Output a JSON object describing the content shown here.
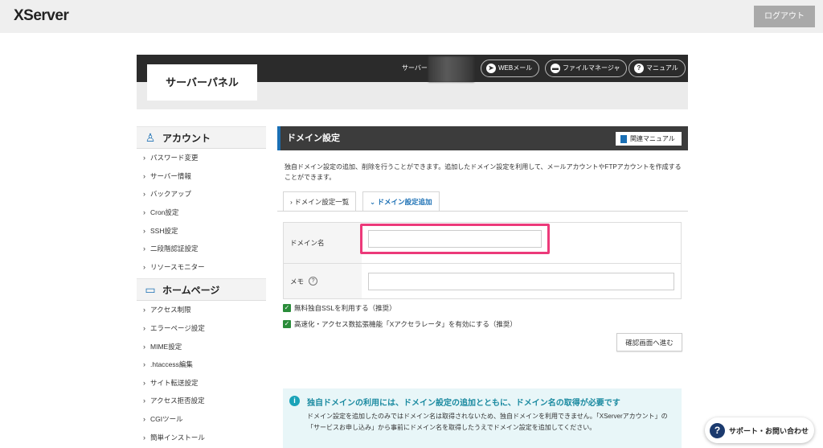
{
  "header": {
    "logo": "XServer",
    "logout_label": "ログアウト"
  },
  "panel": {
    "title": "サーバーパネル",
    "server_label": "サーバー",
    "web_mail": "WEBメール",
    "file_manager": "ファイルマネージャ",
    "manual": "マニュアル"
  },
  "sidebar": {
    "account_heading": "アカウント",
    "account_items": [
      "パスワード変更",
      "サーバー情報",
      "バックアップ",
      "Cron設定",
      "SSH設定",
      "二段階認証設定",
      "リソースモニター"
    ],
    "homepage_heading": "ホームページ",
    "homepage_items": [
      "アクセス制限",
      "エラーページ設定",
      "MIME設定",
      ".htaccess編集",
      "サイト転送設定",
      "アクセス拒否設定",
      "CGIツール",
      "簡単インストール"
    ]
  },
  "main": {
    "title": "ドメイン設定",
    "related_manual": "関連マニュアル",
    "description": "独自ドメイン設定の追加、削除を行うことができます。追加したドメイン設定を利用して、メールアカウントやFTPアカウントを作成することができます。",
    "tabs": [
      {
        "label": "ドメイン設定一覧",
        "active": false
      },
      {
        "label": "ドメイン設定追加",
        "active": true
      }
    ],
    "form": {
      "domain_label": "ドメイン名",
      "domain_value": "",
      "memo_label": "メモ",
      "memo_value": ""
    },
    "ssl_checkbox": "無料独自SSLを利用する（推奨）",
    "xaccel_checkbox": "高速化・アクセス数拡張機能「Xアクセラレータ」を有効にする（推奨）",
    "confirm_button": "確認画面へ進む",
    "info": {
      "title": "独自ドメインの利用には、ドメイン設定の追加とともに、ドメイン名の取得が必要です",
      "text": "ドメイン設定を追加したのみではドメイン名は取得されないため、独自ドメインを利用できません。「XServerアカウント」の「サービスお申し込み」から事前にドメイン名を取得したうえでドメイン設定を追加してください。"
    }
  },
  "support": {
    "label": "サポート・お問い合わせ"
  },
  "colors": {
    "accent": "#1a6fb4",
    "highlight": "#ec3a7a",
    "check": "#2a8c3a"
  }
}
